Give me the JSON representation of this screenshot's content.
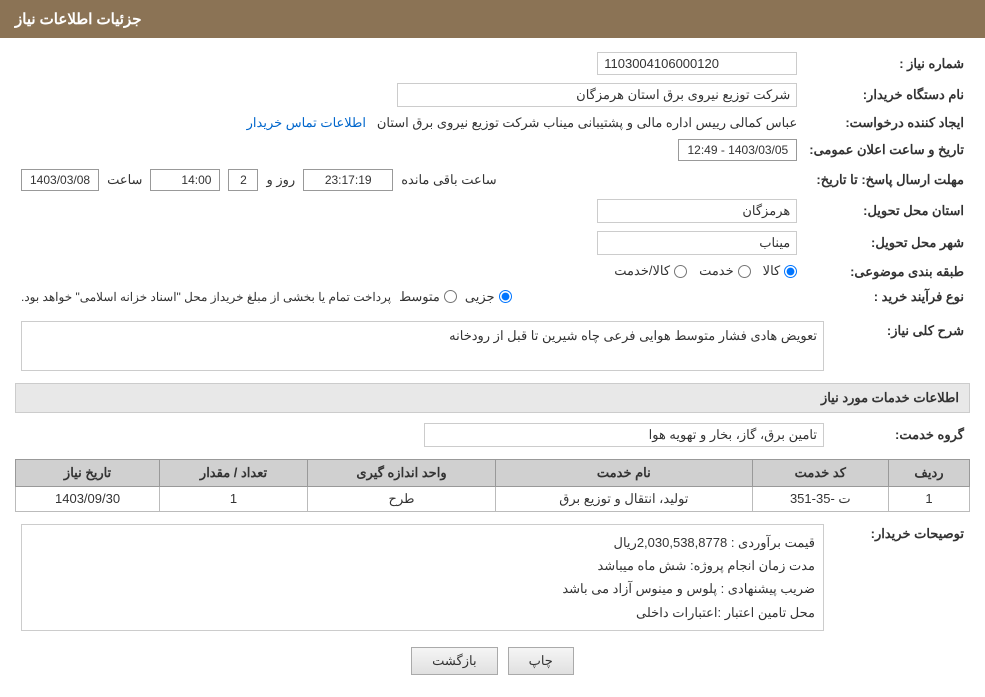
{
  "header": {
    "title": "جزئیات اطلاعات نیاز"
  },
  "fields": {
    "need_number_label": "شماره نیاز :",
    "need_number_value": "1103004106000120",
    "buyer_name_label": "نام دستگاه خریدار:",
    "buyer_name_value": "شرکت توزیع نیروی برق استان هرمزگان",
    "creator_label": "ایجاد کننده درخواست:",
    "creator_value": "عباس کمالی رییس اداره مالی و پشتیبانی میناب شرکت توزیع نیروی برق استان",
    "contact_link_text": "اطلاعات تماس خریدار",
    "send_date_label": "مهلت ارسال پاسخ: تا تاریخ:",
    "announce_datetime_label": "تاریخ و ساعت اعلان عمومی:",
    "announce_datetime_value": "1403/03/05 - 12:49",
    "send_date_value": "1403/03/08",
    "send_time_value": "14:00",
    "days_value": "2",
    "time_remaining_value": "23:17:19",
    "province_label": "استان محل تحویل:",
    "province_value": "هرمزگان",
    "city_label": "شهر محل تحویل:",
    "city_value": "میناب",
    "category_label": "طبقه بندی موضوعی:",
    "category_options": [
      "کالا",
      "خدمت",
      "کالا/خدمت"
    ],
    "category_selected": "کالا",
    "process_label": "نوع فرآیند خرید :",
    "process_options": [
      "جزیی",
      "متوسط"
    ],
    "process_note": "پرداخت تمام یا بخشی از مبلغ خریداز محل \"اسناد خزانه اسلامی\" خواهد بود.",
    "need_description_label": "شرح کلی نیاز:",
    "need_description_value": "تعویض هادی فشار متوسط هوایی فرعی چاه شیرین تا قبل از رودخانه",
    "services_section_title": "اطلاعات خدمات مورد نیاز",
    "service_group_label": "گروه خدمت:",
    "service_group_value": "تامین برق، گاز، بخار و تهویه هوا",
    "table_headers": [
      "ردیف",
      "کد خدمت",
      "نام خدمت",
      "واحد اندازه گیری",
      "تعداد / مقدار",
      "تاریخ نیاز"
    ],
    "table_rows": [
      {
        "row_num": "1",
        "service_code": "ت -35-351",
        "service_name": "تولید، انتقال و توزیع برق",
        "unit": "طرح",
        "quantity": "1",
        "date": "1403/09/30"
      }
    ],
    "buyer_desc_label": "توصیحات خریدار:",
    "buyer_desc_lines": [
      "قیمت برآوردی : 2,030,538,8778ریال",
      "مدت زمان انجام پروژه: شش ماه میباشد",
      "ضریب پیشنهادی : پلوس و مینوس آزاد می باشد",
      "محل تامین اعتبار :اعتبارات داخلی"
    ]
  },
  "buttons": {
    "back_label": "بازگشت",
    "print_label": "چاپ"
  },
  "labels": {
    "days_label": "روز و",
    "time_label": "ساعت",
    "remaining_label": "ساعت باقی مانده"
  }
}
